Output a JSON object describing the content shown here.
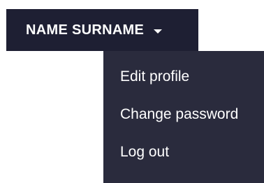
{
  "user_menu": {
    "name": "NAME SURNAME",
    "caret_icon": "chevron-down-icon"
  },
  "dropdown": {
    "items": [
      {
        "label": "Edit profile"
      },
      {
        "label": "Change password"
      },
      {
        "label": "Log out"
      }
    ]
  },
  "colors": {
    "header_bg": "#1e1f33",
    "dropdown_bg": "#2a2b3d",
    "text": "#ffffff"
  }
}
